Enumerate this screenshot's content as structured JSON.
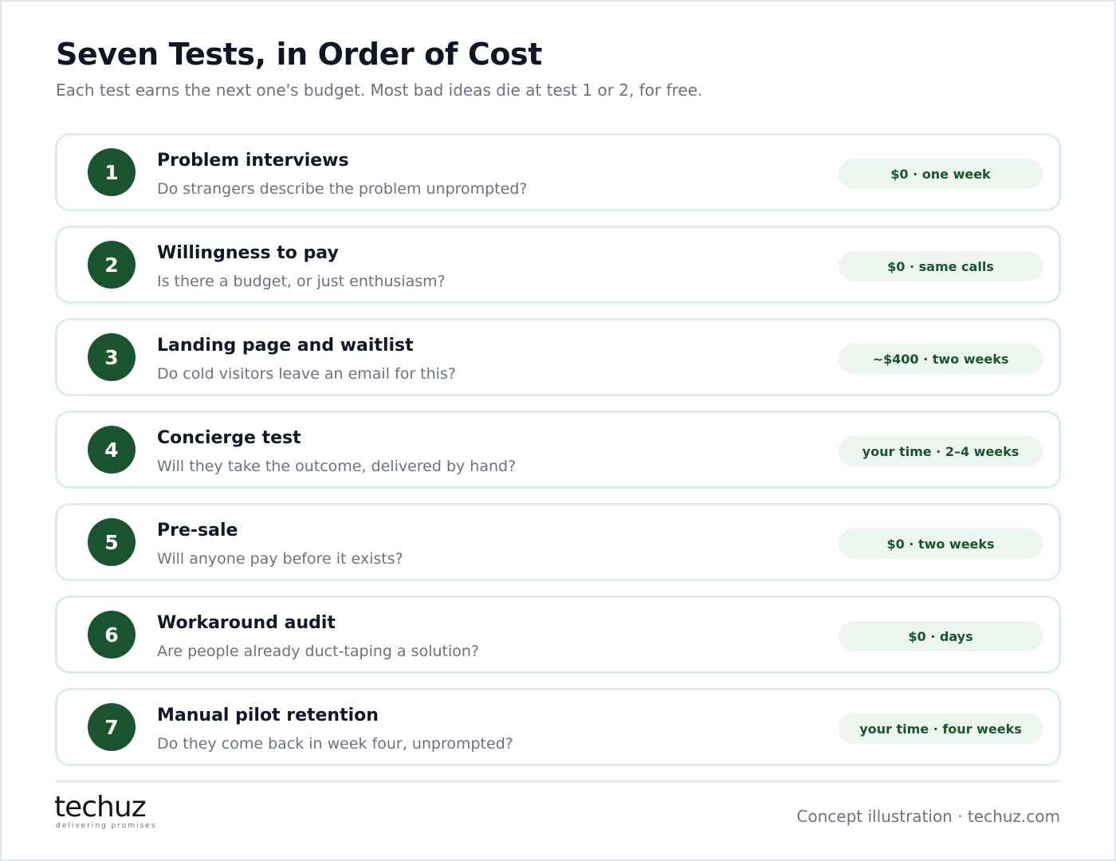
{
  "header": {
    "title": "Seven Tests, in Order of Cost",
    "subtitle": "Each test earns the next one's budget. Most bad ideas die at test 1 or 2, for free."
  },
  "tests": [
    {
      "number": "1",
      "title": "Problem interviews",
      "description": "Do strangers describe the problem unprompted?",
      "cost": "$0 · one week"
    },
    {
      "number": "2",
      "title": "Willingness to pay",
      "description": "Is there a budget, or just enthusiasm?",
      "cost": "$0 · same calls"
    },
    {
      "number": "3",
      "title": "Landing page and waitlist",
      "description": "Do cold visitors leave an email for this?",
      "cost": "~$400 · two weeks"
    },
    {
      "number": "4",
      "title": "Concierge test",
      "description": "Will they take the outcome, delivered by hand?",
      "cost": "your time · 2–4 weeks"
    },
    {
      "number": "5",
      "title": "Pre-sale",
      "description": "Will anyone pay before it exists?",
      "cost": "$0 · two weeks"
    },
    {
      "number": "6",
      "title": "Workaround audit",
      "description": "Are people already duct-taping a solution?",
      "cost": "$0 · days"
    },
    {
      "number": "7",
      "title": "Manual pilot retention",
      "description": "Do they come back in week four, unprompted?",
      "cost": "your time · four weeks"
    }
  ],
  "footer": {
    "logo_word": "techuz",
    "logo_tagline": "delivering promises",
    "note": "Concept illustration · techuz.com"
  },
  "colors": {
    "accent": "#1a5530",
    "card_border": "#dcefe0",
    "pill_background": "#ecf6ee"
  }
}
